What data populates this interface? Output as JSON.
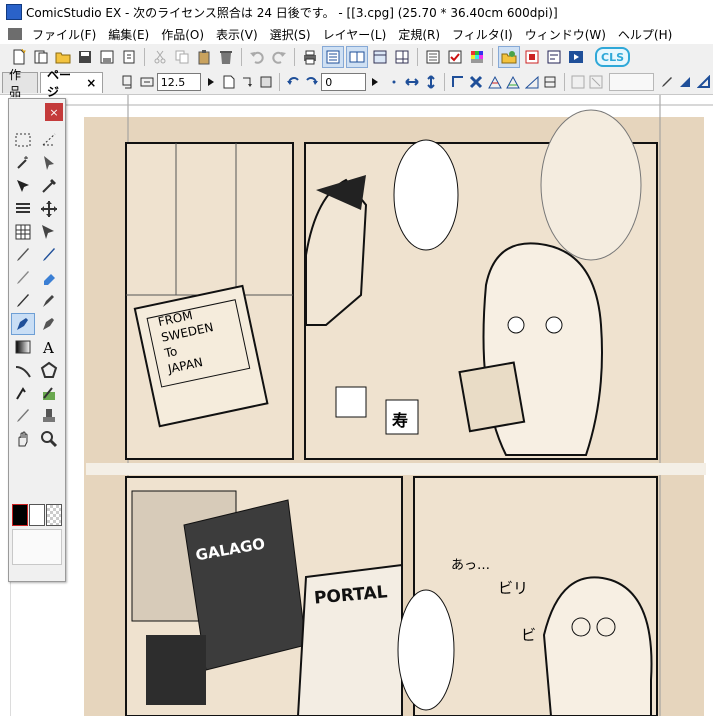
{
  "window": {
    "title": "ComicStudio EX - 次のライセンス照合は 24 日後です。 - [[3.cpg] (25.70 * 36.40cm 600dpi)]"
  },
  "menu": [
    {
      "label": "ファイル(F)"
    },
    {
      "label": "編集(E)"
    },
    {
      "label": "作品(O)"
    },
    {
      "label": "表示(V)"
    },
    {
      "label": "選択(S)"
    },
    {
      "label": "レイヤー(L)"
    },
    {
      "label": "定規(R)"
    },
    {
      "label": "フィルタ(I)"
    },
    {
      "label": "ウィンドウ(W)"
    },
    {
      "label": "ヘルプ(H)"
    }
  ],
  "toolbar": {
    "logo": "CLS"
  },
  "tabs": [
    {
      "label": "作品"
    },
    {
      "label": "ページ",
      "close": "×"
    }
  ],
  "toolbar2": {
    "zoom_value": "12.5",
    "rotation_value": "0"
  },
  "palette": {
    "close": "×"
  },
  "manga": {
    "sign_lines": [
      "FROM",
      "SWEDEN",
      "To",
      "JAPAN"
    ],
    "poster1": "GALAGO",
    "poster2": "PORTAL",
    "mug_char": "寿",
    "sfx_a": "あっ…",
    "sfx_b": "ビリ",
    "sfx_c": "ビ"
  },
  "colors": {
    "accent": "#2fa8d8",
    "panel_bg": "#efe2cf",
    "page_bg": "#e6d5bd"
  }
}
